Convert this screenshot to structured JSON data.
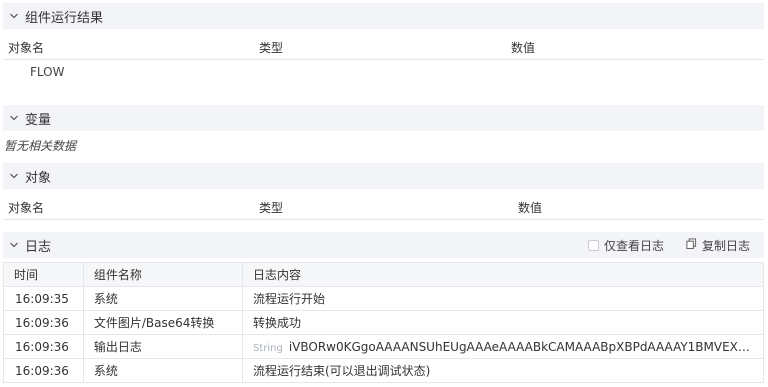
{
  "component_result": {
    "title": "组件运行结果",
    "columns": [
      "对象名",
      "类型",
      "数值"
    ],
    "rows": [
      "FLOW"
    ]
  },
  "variables": {
    "title": "变量",
    "empty_text": "暂无相关数据"
  },
  "objects": {
    "title": "对象",
    "columns": [
      "对象名",
      "类型",
      "数值"
    ]
  },
  "log": {
    "title": "日志",
    "only_view_log": "仅查看日志",
    "copy_log": "复制日志",
    "columns": [
      "时间",
      "组件名称",
      "日志内容"
    ],
    "rows": [
      {
        "time": "16:09:35",
        "component": "系统",
        "tag": "",
        "content": "流程运行开始"
      },
      {
        "time": "16:09:36",
        "component": "文件图片/Base64转换",
        "tag": "",
        "content": "转换成功"
      },
      {
        "time": "16:09:36",
        "component": "输出日志",
        "tag": "String",
        "content": "iVBORw0KGgoAAAANSUhEUgAAAeAAAABkCAMAAABpXBPdAAAAY1BMVEXz+/6..."
      },
      {
        "time": "16:09:36",
        "component": "系统",
        "tag": "",
        "content": "流程运行结束(可以退出调试状态)"
      }
    ]
  }
}
